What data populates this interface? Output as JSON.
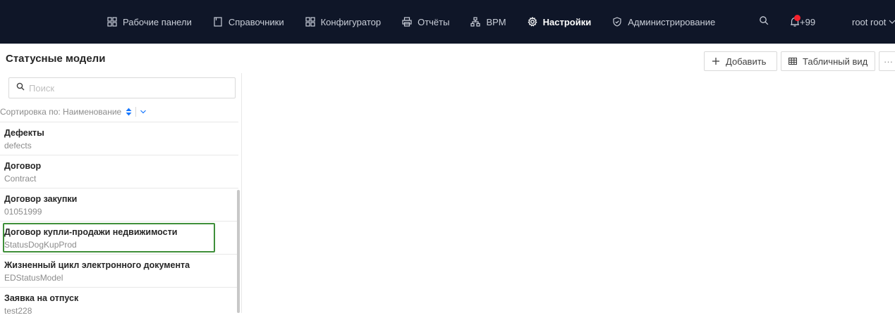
{
  "nav": {
    "items": [
      {
        "label": "Рабочие панели",
        "icon": "grid-icon"
      },
      {
        "label": "Справочники",
        "icon": "book-icon"
      },
      {
        "label": "Конфигуратор",
        "icon": "grid-icon"
      },
      {
        "label": "Отчёты",
        "icon": "printer-icon"
      },
      {
        "label": "BPM",
        "icon": "hierarchy-icon"
      },
      {
        "label": "Настройки",
        "icon": "gear-icon",
        "active": true
      },
      {
        "label": "Администрирование",
        "icon": "shield-icon"
      }
    ],
    "notifications": "+99",
    "user": "root root"
  },
  "header": {
    "title": "Статусные модели",
    "add_label": "Добавить",
    "table_view_label": "Табличный вид",
    "more_label": "···"
  },
  "sidebar": {
    "search_placeholder": "Поиск",
    "sort_label": "Сортировка по: Наименование",
    "items": [
      {
        "name": "Дефекты",
        "code": "defects"
      },
      {
        "name": "Договор",
        "code": "Contract"
      },
      {
        "name": "Договор закупки",
        "code": "01051999"
      },
      {
        "name": "Договор купли-продажи недвижимости",
        "code": "StatusDogKupProd",
        "selected": true
      },
      {
        "name": "Жизненный цикл электронного документа",
        "code": "EDStatusModel"
      },
      {
        "name": "Заявка на отпуск",
        "code": "test228"
      }
    ]
  },
  "colors": {
    "topbar_bg": "#0f1628",
    "selected_outline": "#3f8f3a",
    "notification_dot": "#f5222d"
  }
}
